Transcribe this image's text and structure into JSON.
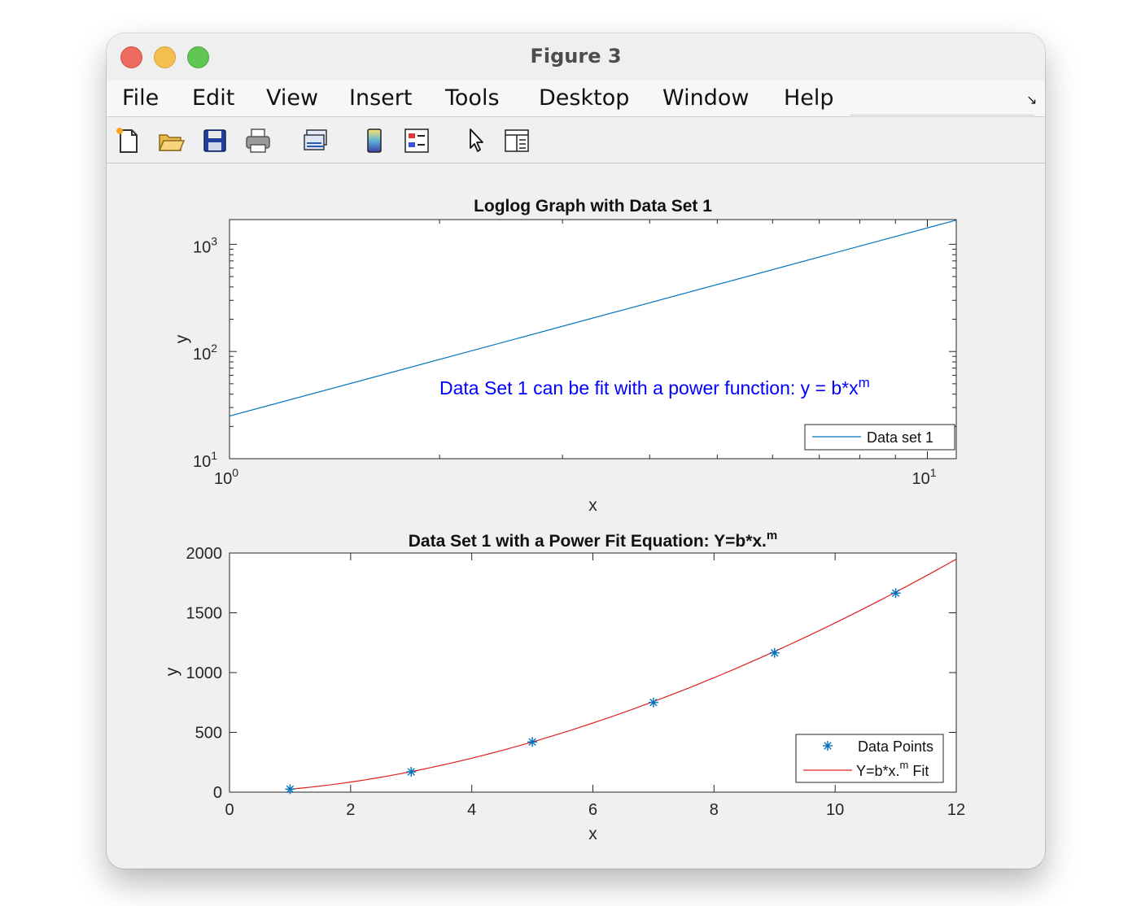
{
  "window": {
    "title": "Figure 3"
  },
  "menu": {
    "items": [
      "File",
      "Edit",
      "View",
      "Insert",
      "Tools",
      "Desktop",
      "Window",
      "Help"
    ]
  },
  "toolbar": {
    "icons": [
      "new-figure-icon",
      "open-file-icon",
      "save-icon",
      "print-icon",
      "link-plot-icon",
      "colorbar-icon",
      "legend-icon",
      "pointer-icon",
      "property-inspector-icon"
    ]
  },
  "colors": {
    "series_blue": "#0072bd",
    "fit_red": "#e02020",
    "annotation_blue": "#0000ff"
  },
  "chart_data": [
    {
      "type": "line",
      "title": "Loglog Graph with Data Set 1",
      "xlabel": "x",
      "ylabel": "y",
      "xscale": "log",
      "yscale": "log",
      "xlim": [
        1,
        11
      ],
      "ylim": [
        10,
        1700
      ],
      "xticklabels": [
        {
          "base": "10",
          "exp": "0",
          "value": 1
        },
        {
          "base": "10",
          "exp": "1",
          "value": 10
        }
      ],
      "yticklabels": [
        {
          "base": "10",
          "exp": "1",
          "value": 10
        },
        {
          "base": "10",
          "exp": "2",
          "value": 100
        },
        {
          "base": "10",
          "exp": "3",
          "value": 1000
        }
      ],
      "series": [
        {
          "name": "Data set 1",
          "x": [
            1,
            11
          ],
          "y": [
            25,
            1680
          ],
          "color": "#0072bd"
        }
      ],
      "annotation": {
        "text": "Data Set 1 can be fit with a power function:  y = b*x",
        "sup": "m"
      },
      "legend": {
        "placement": "bottom-right"
      }
    },
    {
      "type": "line",
      "title": {
        "text": "Data Set 1 with a Power Fit Equation: Y=b*x.",
        "sup": "m"
      },
      "xlabel": "x",
      "ylabel": "y",
      "xlim": [
        0,
        12
      ],
      "ylim": [
        0,
        2000
      ],
      "xticks": [
        0,
        2,
        4,
        6,
        8,
        10,
        12
      ],
      "yticks": [
        0,
        500,
        1000,
        1500,
        2000
      ],
      "series": [
        {
          "name": "Data Points",
          "marker": "*",
          "x": [
            1,
            3,
            5,
            7,
            9,
            11
          ],
          "y": [
            25,
            170,
            420,
            750,
            1165,
            1665
          ],
          "color": "#0072bd"
        },
        {
          "name": {
            "text": "Y=b*x.",
            "sup": "m",
            "tail": " Fit"
          },
          "line": true,
          "b": 25,
          "m": 1.753,
          "xrange": [
            1,
            12
          ],
          "color": "#e02020"
        }
      ],
      "legend": {
        "placement": "bottom-right"
      }
    }
  ]
}
